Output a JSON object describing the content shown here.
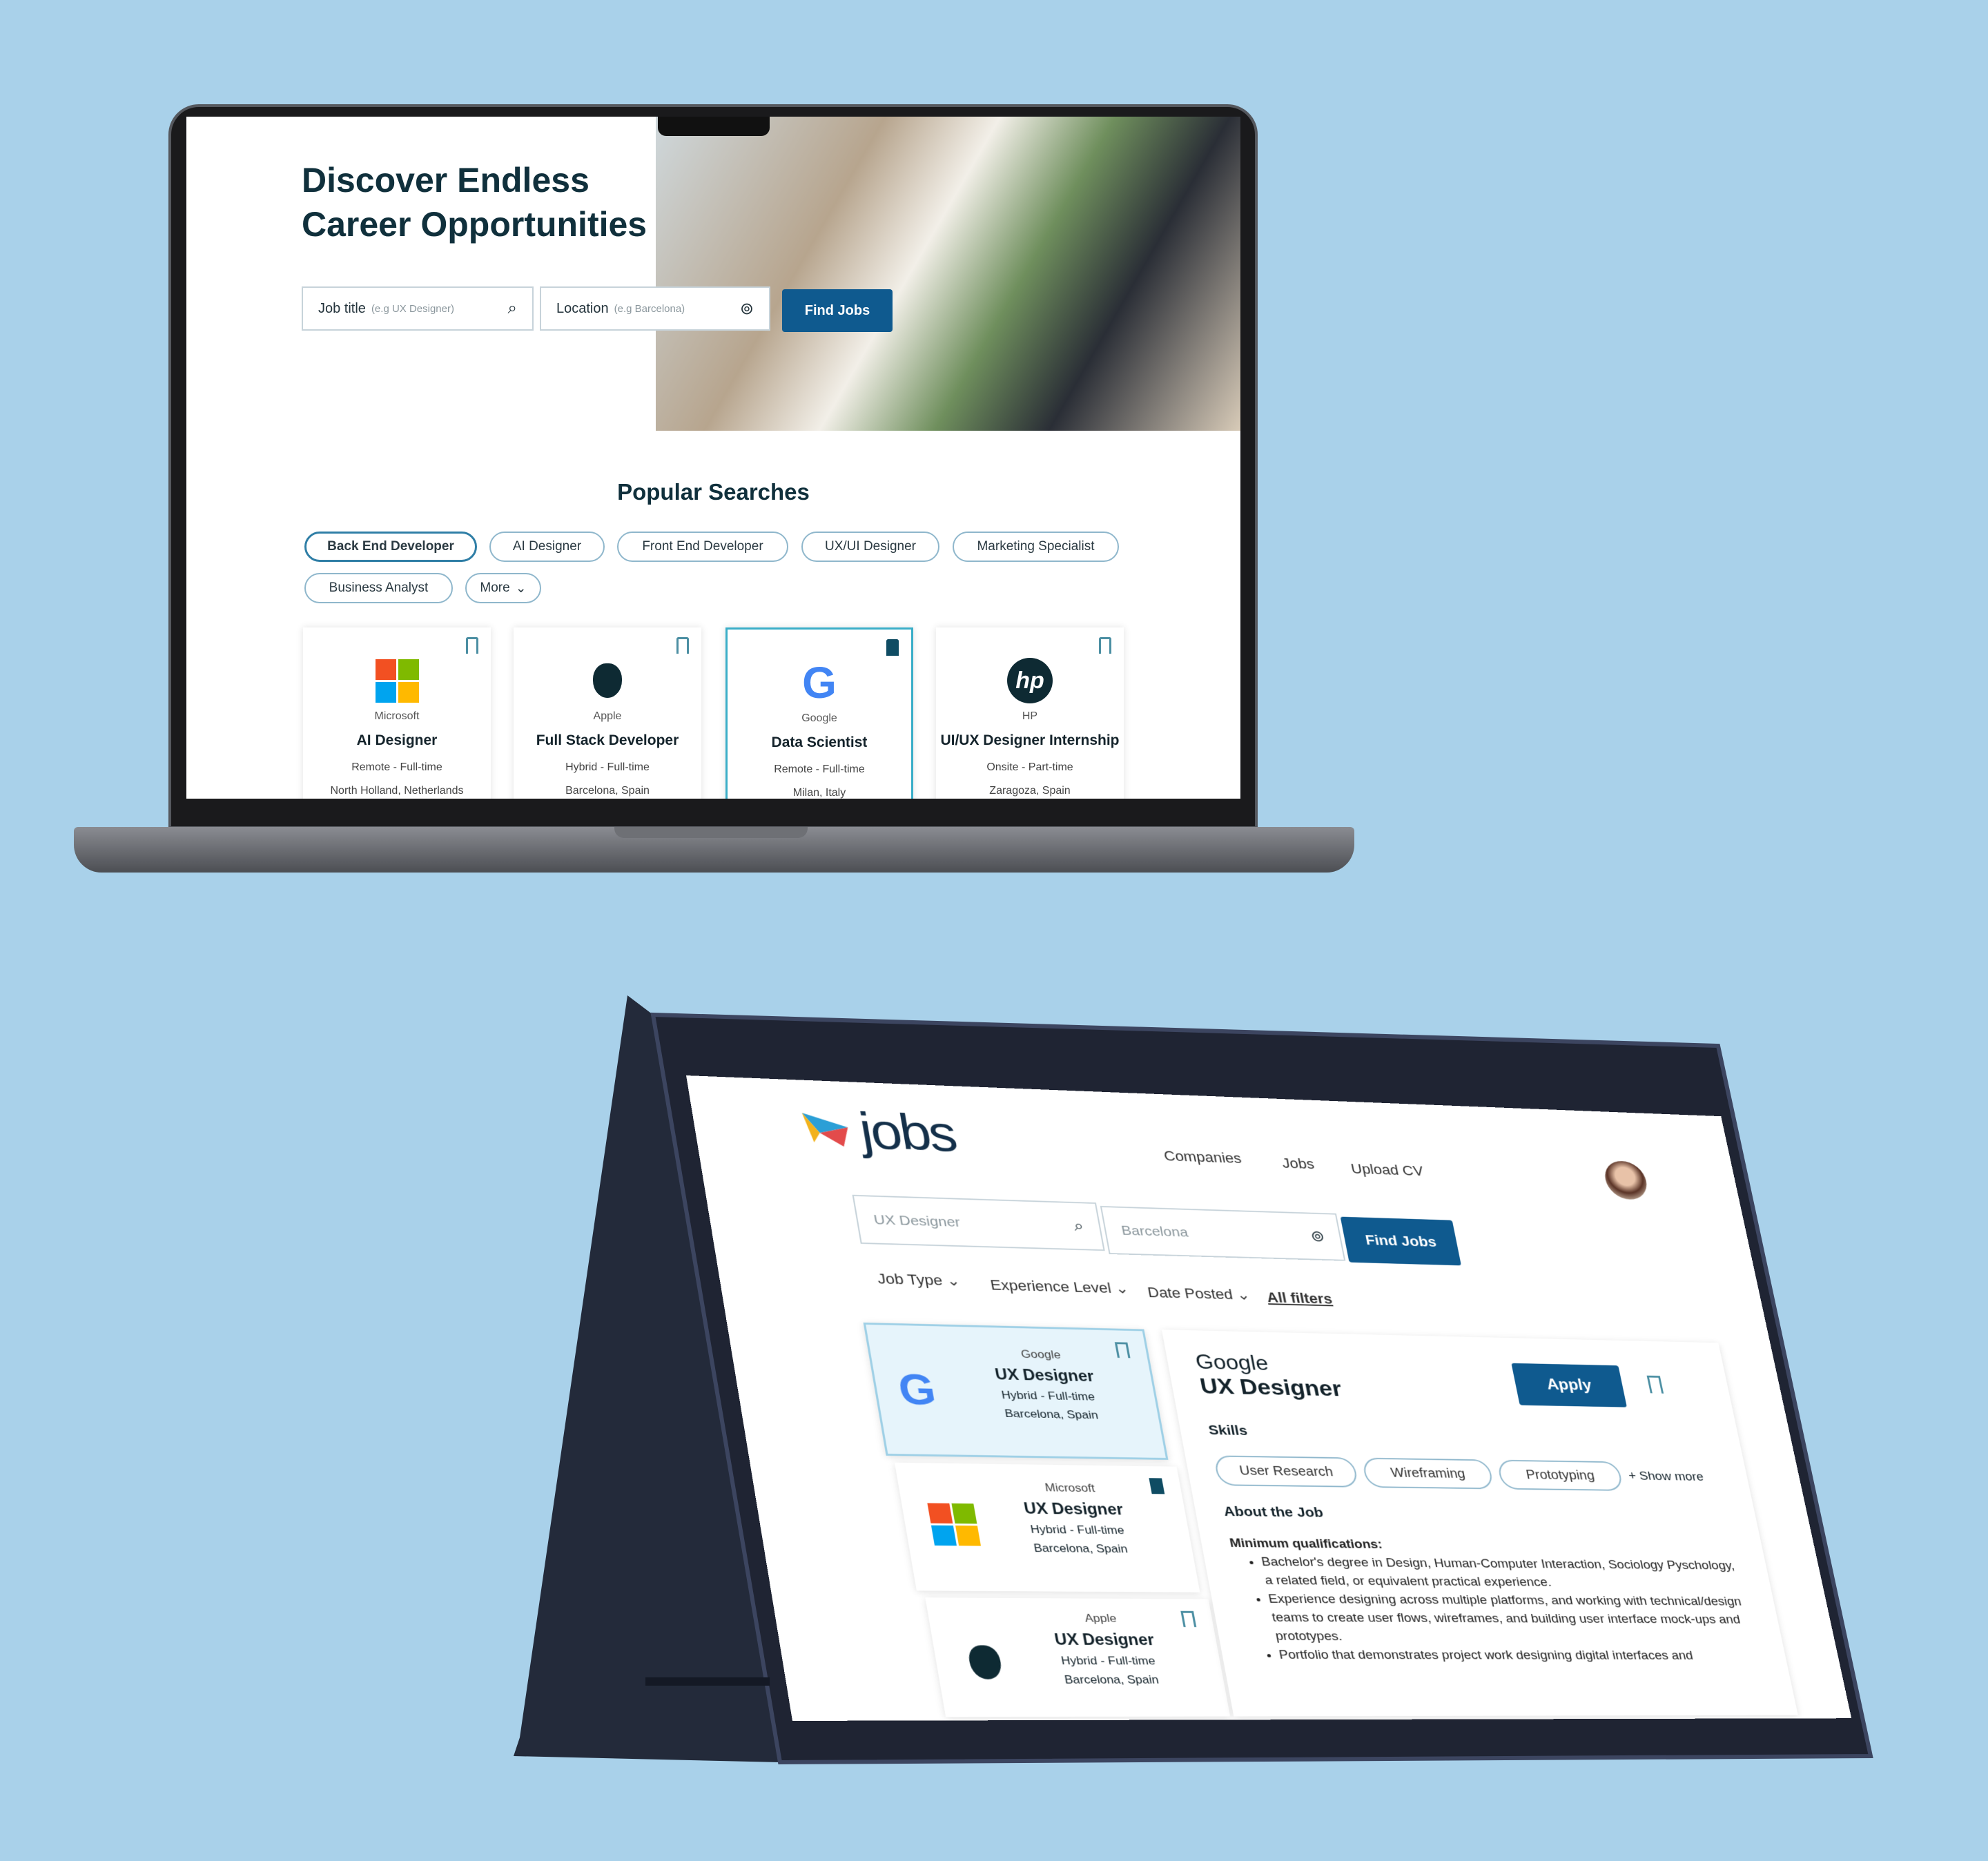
{
  "laptop": {
    "hero": {
      "title_line1": "Discover Endless",
      "title_line2": "Career Opportunities"
    },
    "search": {
      "job_label": "Job title",
      "job_placeholder": "(e.g UX Designer)",
      "location_label": "Location",
      "location_placeholder": "(e.g Barcelona)",
      "find_label": "Find Jobs"
    },
    "popular": {
      "title": "Popular Searches",
      "chips": [
        "Back End Developer",
        "AI Designer",
        "Front End Developer",
        "UX/UI Designer",
        "Marketing Specialist",
        "Business Analyst"
      ],
      "more": "More"
    },
    "cards": [
      {
        "company": "Microsoft",
        "title": "AI Designer",
        "type": "Remote - Full-time",
        "location": "North Holland, Netherlands",
        "saved": false
      },
      {
        "company": "Apple",
        "title": "Full Stack Developer",
        "type": "Hybrid - Full-time",
        "location": "Barcelona, Spain",
        "saved": false
      },
      {
        "company": "Google",
        "title": "Data Scientist",
        "type": "Remote - Full-time",
        "location": "Milan, Italy",
        "saved": true
      },
      {
        "company": "HP",
        "title": "UI/UX Designer Internship",
        "type": "Onsite - Part-time",
        "location": "Zaragoza, Spain",
        "saved": false
      }
    ]
  },
  "tablet": {
    "logo": "jobs",
    "nav": [
      "Companies",
      "Jobs",
      "Upload CV"
    ],
    "search": {
      "job_value": "UX Designer",
      "location_value": "Barcelona",
      "find_label": "Find Jobs"
    },
    "filters": [
      "Job Type",
      "Experience Level",
      "Date Posted"
    ],
    "all_filters": "All filters",
    "list": [
      {
        "company": "Google",
        "title": "UX Designer",
        "type": "Hybrid - Full-time",
        "location": "Barcelona, Spain",
        "saved": false
      },
      {
        "company": "Microsoft",
        "title": "UX Designer",
        "type": "Hybrid - Full-time",
        "location": "Barcelona, Spain",
        "saved": true
      },
      {
        "company": "Apple",
        "title": "UX Designer",
        "type": "Hybrid - Full-time",
        "location": "Barcelona, Spain",
        "saved": false
      }
    ],
    "detail": {
      "company": "Google",
      "title": "UX Designer",
      "apply": "Apply",
      "skills_label": "Skills",
      "skills": [
        "User Research",
        "Wireframing",
        "Prototyping"
      ],
      "show_more": "+ Show more",
      "about_label": "About the Job",
      "min_label": "Minimum qualifications:",
      "bullets": [
        "Bachelor's degree in Design, Human-Computer Interaction, Sociology Pyschology, a related field, or equivalent practical experience.",
        "Experience designing across multiple platforms, and working with technical/design teams to create user flows, wireframes, and building user interface mock-ups and prototypes.",
        "Portfolio that demonstrates project work designing digital interfaces and"
      ]
    }
  },
  "colors": {
    "background": "#a9d1ea",
    "primary": "#0f5a8f",
    "chip_border": "#8fb7cc",
    "selected_card": "#3aaec8"
  }
}
